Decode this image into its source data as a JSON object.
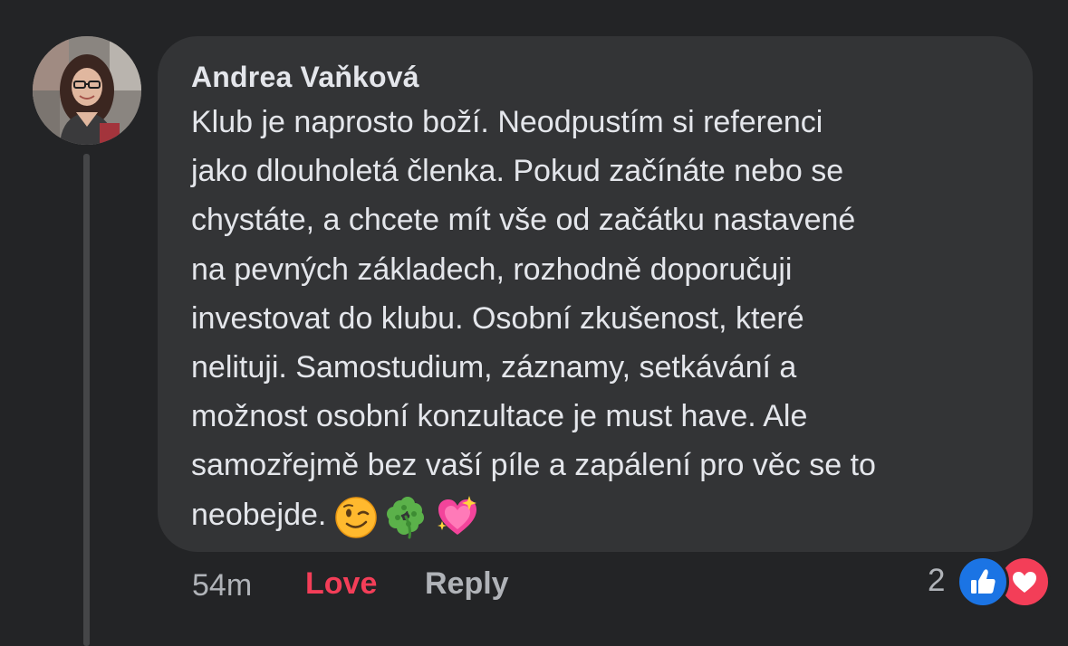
{
  "comment": {
    "author": "Andrea Vaňková",
    "lines": [
      "Klub je naprosto boží. Neodpustím si referenci",
      "jako dlouholetá členka. Pokud začínáte nebo se",
      "chystáte, a chcete mít vše od začátku nastavené",
      "na pevných základech, rozhodně doporučuji",
      "investovat do klubu. Osobní zkušenost, které",
      "nelituji. Samostudium, záznamy, setkávání a",
      "možnost osobní konzultace je must have. Ale",
      "samozřejmě bez vaší píle a zapálení pro věc se to",
      "neobejde."
    ],
    "emojis": [
      "winking-face",
      "four-leaf-clover",
      "sparkling-heart"
    ]
  },
  "actions": {
    "timestamp": "54m",
    "love_label": "Love",
    "reply_label": "Reply"
  },
  "reactions": {
    "count": "2",
    "types": [
      "like",
      "love"
    ]
  },
  "colors": {
    "background": "#232426",
    "bubble": "#333436",
    "text": "#e4e6eb",
    "muted": "#b0b3b8",
    "love": "#f33e58",
    "like": "#1b74e4"
  }
}
